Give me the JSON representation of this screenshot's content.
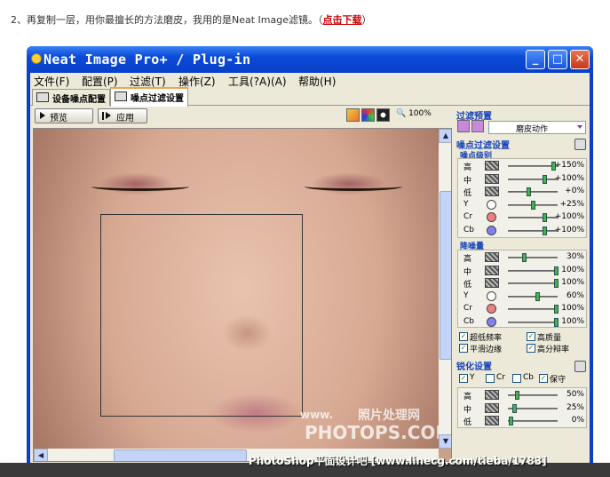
{
  "caption": {
    "text": "2、再复制一层，用你最擅长的方法磨皮，我用的是Neat Image滤镜。（",
    "link": "点击下载",
    "end": "）"
  },
  "window": {
    "title": "Neat Image Pro+ / Plug-in",
    "minimize": "_",
    "maximize": "□",
    "close": "✕"
  },
  "menu": [
    "文件(F)",
    "配置(P)",
    "过滤(T)",
    "操作(Z)",
    "工具(?A)(A)",
    "帮助(H)"
  ],
  "tabs": [
    {
      "label": "设备噪点配置",
      "icon": "device-icon"
    },
    {
      "label": "噪点过滤设置",
      "icon": "filter-icon"
    }
  ],
  "toolbar": {
    "preview": "预览",
    "apply": "应用",
    "zoom": "100%"
  },
  "watermarks": {
    "www": "www.",
    "site_cn": "照片处理网",
    "site": "PHOTOPS.COM",
    "forum": "PhotoShop平面设计吧 [www.linecg.com/tieba/1783]"
  },
  "presets": {
    "title": "过滤预置",
    "selected": "磨皮动作"
  },
  "noise_filter": {
    "title": "噪点过滤设置",
    "levels_title": "噪点级别",
    "levels": [
      {
        "label": "高",
        "kind": "swatch",
        "value": "+150%",
        "pos": 0.95
      },
      {
        "label": "中",
        "kind": "swatch",
        "value": "+100%",
        "pos": 0.75
      },
      {
        "label": "低",
        "kind": "swatch",
        "value": "+0%",
        "pos": 0.4
      },
      {
        "label": "Y",
        "kind": "dot",
        "color": "#ffffff",
        "value": "+25%",
        "pos": 0.5
      },
      {
        "label": "Cr",
        "kind": "dot",
        "color": "#f08080",
        "value": "+100%",
        "pos": 0.75
      },
      {
        "label": "Cb",
        "kind": "dot",
        "color": "#8080f0",
        "value": "+100%",
        "pos": 0.75
      }
    ],
    "amount_title": "降噪量",
    "amounts": [
      {
        "label": "高",
        "kind": "swatch",
        "value": "30%",
        "pos": 0.3
      },
      {
        "label": "中",
        "kind": "swatch",
        "value": "100%",
        "pos": 1.0
      },
      {
        "label": "低",
        "kind": "swatch",
        "value": "100%",
        "pos": 1.0
      },
      {
        "label": "Y",
        "kind": "dot",
        "color": "#ffffff",
        "value": "60%",
        "pos": 0.6
      },
      {
        "label": "Cr",
        "kind": "dot",
        "color": "#f08080",
        "value": "100%",
        "pos": 1.0
      },
      {
        "label": "Cb",
        "kind": "dot",
        "color": "#8080f0",
        "value": "100%",
        "pos": 1.0
      }
    ],
    "checks": [
      {
        "label": "超低频率",
        "checked": true
      },
      {
        "label": "高质量",
        "checked": true
      },
      {
        "label": "平滑边缘",
        "checked": true
      },
      {
        "label": "高分辩率",
        "checked": true
      }
    ]
  },
  "sharpen": {
    "title": "锐化设置",
    "channels": [
      {
        "label": "Y",
        "checked": true
      },
      {
        "label": "Cr",
        "checked": false
      },
      {
        "label": "Cb",
        "checked": false
      },
      {
        "label": "保守",
        "checked": true
      }
    ],
    "rows": [
      {
        "label": "高",
        "value": "50%",
        "pos": 0.15
      },
      {
        "label": "中",
        "value": "25%",
        "pos": 0.1
      },
      {
        "label": "低",
        "value": "0%",
        "pos": 0.02
      }
    ]
  }
}
